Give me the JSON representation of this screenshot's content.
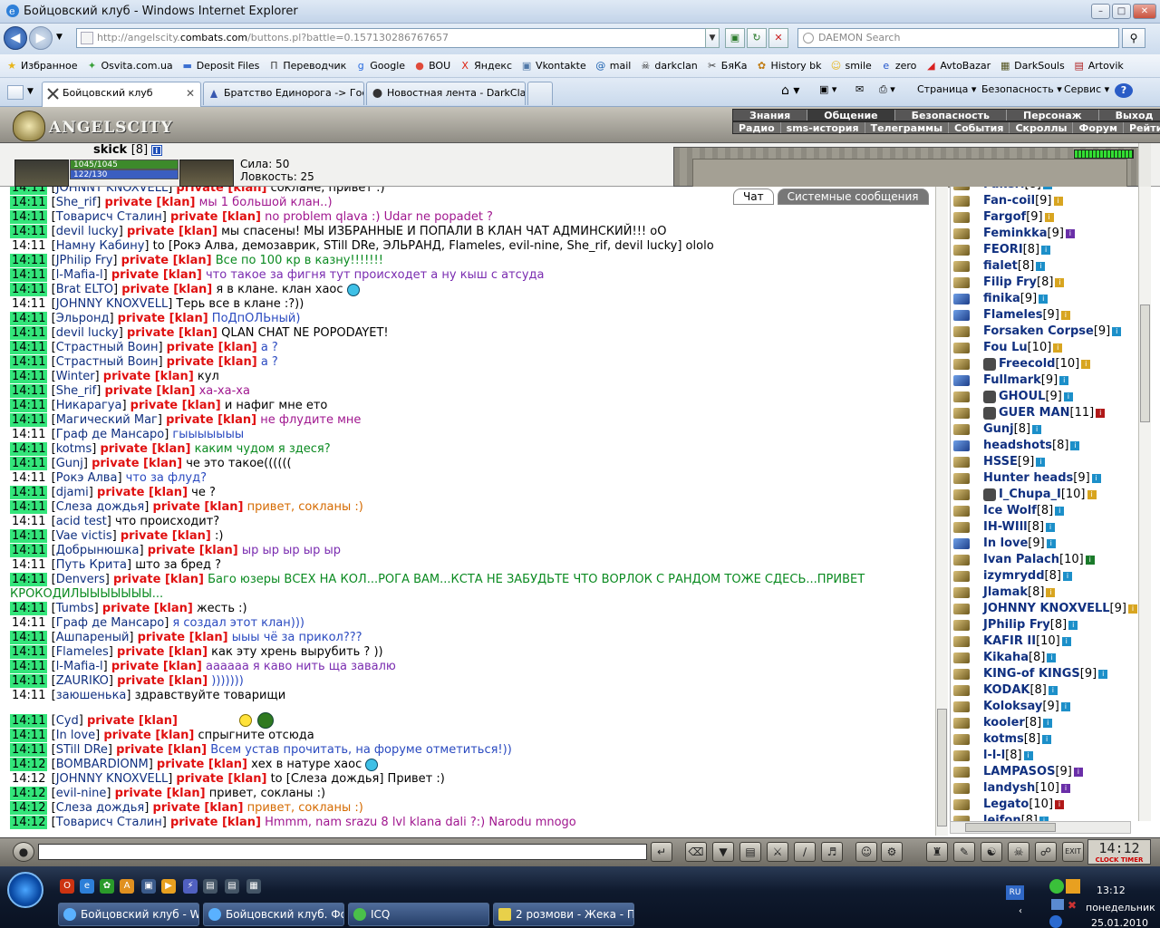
{
  "window": {
    "title": "Бойцовский клуб - Windows Internet Explorer",
    "controls": [
      "–",
      "□",
      "✕"
    ]
  },
  "address": {
    "prefix": "http://angelscity.",
    "domain": "combats.com",
    "suffix": "/buttons.pl?battle=0.157130286767657",
    "search_placeholder": "DAEMON Search"
  },
  "favorites": [
    {
      "label": "Избранное",
      "icon": "★",
      "color": "#e8b51a"
    },
    {
      "label": "Osvita.com.ua",
      "icon": "✦",
      "color": "#3aa03a"
    },
    {
      "label": "Deposit Files",
      "icon": "▬",
      "color": "#3b6fd1"
    },
    {
      "label": "Переводчик",
      "icon": "П",
      "color": "#444"
    },
    {
      "label": "Google",
      "icon": "g",
      "color": "#2a6ce0"
    },
    {
      "label": "BOU",
      "icon": "●",
      "color": "#e04a3a"
    },
    {
      "label": "Яндекс",
      "icon": "X",
      "color": "#d21"
    },
    {
      "label": "Vkontakte",
      "icon": "▣",
      "color": "#5078a8"
    },
    {
      "label": "mail",
      "icon": "@",
      "color": "#1a60b0"
    },
    {
      "label": "darkclan",
      "icon": "☠",
      "color": "#222"
    },
    {
      "label": "БяКа",
      "icon": "✂",
      "color": "#333"
    },
    {
      "label": "History bk",
      "icon": "✿",
      "color": "#c07a10"
    },
    {
      "label": "smile",
      "icon": "☺",
      "color": "#e8b51a"
    },
    {
      "label": "zero",
      "icon": "e",
      "color": "#2255cc"
    },
    {
      "label": "AvtoBazar",
      "icon": "◢",
      "color": "#d82020"
    },
    {
      "label": "DarkSouls",
      "icon": "▦",
      "color": "#552"
    },
    {
      "label": "Artovik",
      "icon": "▤",
      "color": "#b02020"
    }
  ],
  "tabs": [
    {
      "label": "Бойцовский клуб",
      "active": true,
      "close": "✕"
    },
    {
      "label": "Братство Единорога -> Гос...",
      "active": false
    },
    {
      "label": "Новостная лента - DarkClan",
      "active": false
    }
  ],
  "command_bar": {
    "page": "Страница",
    "safety": "Безопасность",
    "service": "Сервис",
    "help": "?"
  },
  "game": {
    "logo_text": "ANGELSCITY",
    "menu_top": [
      "Знания",
      "Общение",
      "Безопасность",
      "Персонаж",
      "Выход"
    ],
    "menu_bottom": [
      "Радио",
      "sms-история",
      "Телеграммы",
      "События",
      "Скроллы",
      "Форум",
      "Рейтинг"
    ],
    "user": {
      "name": "skick",
      "level": "[8]",
      "info": "i",
      "hp": "1045/1045",
      "mp": "122/130",
      "stat1": "Сила: 50",
      "stat2": "Ловкость: 25"
    },
    "chat_tabs": [
      "Чат",
      "Системные сообщения"
    ],
    "private_label": "private [klan]"
  },
  "chat": [
    {
      "t": "14:11",
      "g": true,
      "n": "JOHNNY KNOXVELL",
      "p": true,
      "m": "соклане, привет :)",
      "c": "#000"
    },
    {
      "t": "14:11",
      "g": true,
      "n": "She_rif",
      "p": true,
      "m": "мы 1 большой клан..)",
      "c": "#a0178f"
    },
    {
      "t": "14:11",
      "g": true,
      "n": "Товарисч Сталин",
      "p": true,
      "m": "no problem qlava :) Udar ne popadet ?",
      "c": "#a0178f"
    },
    {
      "t": "14:11",
      "g": true,
      "n": "devil lucky",
      "p": true,
      "m": "мы спасены! МЫ ИЗБРАННЫЕ И ПОПАЛИ В КЛАН ЧАТ АДМИНСКИЙ!!! оО",
      "c": "#000"
    },
    {
      "t": "14:11",
      "g": false,
      "n": "Намну Кабину",
      "p": false,
      "m": "to [Рокэ Алва, демозаврик, STill DRe, ЭЛЬРАНД, Flameles, evil-nine, She_rif, devil lucky] ololo",
      "c": "#000"
    },
    {
      "t": "14:11",
      "g": true,
      "n": "JPhilip Fry",
      "p": true,
      "m": "Все по 100 кр в казну!!!!!!!",
      "c": "#0a8a20"
    },
    {
      "t": "14:11",
      "g": true,
      "n": "l-Mafia-l",
      "p": true,
      "m": "что такое за фигня тут происходет а ну кыш с атсуда",
      "c": "#7a2cb0"
    },
    {
      "t": "14:11",
      "g": true,
      "n": "Brat ELTO",
      "p": true,
      "m": "я в клане. клан хаос",
      "c": "#000",
      "s": "b"
    },
    {
      "t": "14:11",
      "g": false,
      "n": "JOHNNY KNOXVELL",
      "p": false,
      "m": "Терь все в клане :?))",
      "c": "#000"
    },
    {
      "t": "14:11",
      "g": true,
      "n": "Эльронд",
      "p": true,
      "m": "ПоДпОЛЬный)",
      "c": "#2a4ac0"
    },
    {
      "t": "14:11",
      "g": true,
      "n": "devil lucky",
      "p": true,
      "m": "QLAN CHAT NE POPODAYET!",
      "c": "#000"
    },
    {
      "t": "14:11",
      "g": true,
      "n": "Страстный Воин",
      "p": true,
      "m": "а ?",
      "c": "#2a4ac0"
    },
    {
      "t": "14:11",
      "g": true,
      "n": "Страстный Воин",
      "p": true,
      "m": "а ?",
      "c": "#2a4ac0"
    },
    {
      "t": "14:11",
      "g": true,
      "n": "Winter",
      "p": true,
      "m": "кул",
      "c": "#000"
    },
    {
      "t": "14:11",
      "g": true,
      "n": "She_rif",
      "p": true,
      "m": "ха-ха-ха",
      "c": "#a0178f"
    },
    {
      "t": "14:11",
      "g": true,
      "n": "Никарагуа",
      "p": true,
      "m": "и нафиг мне ето",
      "c": "#000"
    },
    {
      "t": "14:11",
      "g": true,
      "n": "Магический Маг",
      "p": true,
      "m": "не флудите мне",
      "c": "#a0178f"
    },
    {
      "t": "14:11",
      "g": false,
      "n": "Граф де Мансаро",
      "p": false,
      "m": "гыыыыыыы",
      "c": "#2a4ac0"
    },
    {
      "t": "14:11",
      "g": true,
      "n": "kotms",
      "p": true,
      "m": "каким чудом я здеся?",
      "c": "#0a8a20"
    },
    {
      "t": "14:11",
      "g": true,
      "n": "Gunj",
      "p": true,
      "m": "че это такое((((((",
      "c": "#000"
    },
    {
      "t": "14:11",
      "g": false,
      "n": "Рокэ Алва",
      "p": false,
      "m": "что за флуд?",
      "c": "#2a4ac0"
    },
    {
      "t": "14:11",
      "g": true,
      "n": "djami",
      "p": true,
      "m": "че ?",
      "c": "#000"
    },
    {
      "t": "14:11",
      "g": true,
      "n": "Слеза дождья",
      "p": true,
      "m": "привет, сокланы :)",
      "c": "#d56a00"
    },
    {
      "t": "14:11",
      "g": false,
      "n": "acid test",
      "p": false,
      "m": "что происходит?",
      "c": "#000"
    },
    {
      "t": "14:11",
      "g": true,
      "n": "Vae victis",
      "p": true,
      "m": ":)",
      "c": "#000"
    },
    {
      "t": "14:11",
      "g": true,
      "n": "Добрынюшка",
      "p": true,
      "m": "ыр ыр ыр ыр ыр",
      "c": "#7a2cb0"
    },
    {
      "t": "14:11",
      "g": false,
      "n": "Путь Крита",
      "p": false,
      "m": "што за бред ?",
      "c": "#000"
    },
    {
      "t": "14:11",
      "g": true,
      "n": "Denvers",
      "p": true,
      "m": "Баго юзеры ВСЕХ НА КОЛ...РОГА ВАМ...КСТА НЕ ЗАБУДЬТЕ ЧТО ВОРЛОК С РАНДОМ ТОЖЕ СДЕСЬ...ПРИВЕТ КРОКОДИЛЫЫЫЫЫЫЫ...",
      "c": "#0a8a20",
      "w": true
    },
    {
      "t": "14:11",
      "g": true,
      "n": "Tumbs",
      "p": true,
      "m": "жесть :)",
      "c": "#000"
    },
    {
      "t": "14:11",
      "g": false,
      "n": "Граф де Мансаро",
      "p": false,
      "m": "я создал этот клан)))",
      "c": "#2a4ac0"
    },
    {
      "t": "14:11",
      "g": true,
      "n": "Ашпареный",
      "p": true,
      "m": "ыыы чё за прикол???",
      "c": "#2a4ac0"
    },
    {
      "t": "14:11",
      "g": true,
      "n": "Flameles",
      "p": true,
      "m": "как эту хрень вырубить ? ))",
      "c": "#000"
    },
    {
      "t": "14:11",
      "g": true,
      "n": "l-Mafia-l",
      "p": true,
      "m": "аааааа я каво нить ща завалю",
      "c": "#7a2cb0"
    },
    {
      "t": "14:11",
      "g": true,
      "n": "ZAURIKO",
      "p": true,
      "m": ")))))))",
      "c": "#2a4ac0"
    },
    {
      "t": "14:11",
      "g": false,
      "n": "заюшенька",
      "p": false,
      "m": "здравствуйте товарищи",
      "c": "#000"
    },
    {
      "gap": true
    },
    {
      "t": "14:11",
      "g": true,
      "n": "Cyd",
      "p": true,
      "m": "",
      "c": "#000",
      "s": "cyd"
    },
    {
      "t": "14:11",
      "g": true,
      "n": "In love",
      "p": true,
      "m": "спрыгните отсюда",
      "c": "#000"
    },
    {
      "t": "14:11",
      "g": true,
      "n": "STill DRe",
      "p": true,
      "m": "Всем устав прочитать, на форуме отметиться!))",
      "c": "#2a4ac0"
    },
    {
      "t": "14:12",
      "g": true,
      "n": "BOMBARDIONM",
      "p": true,
      "m": "хех в натуре хаос",
      "c": "#000",
      "s": "b"
    },
    {
      "t": "14:12",
      "g": false,
      "n": "JOHNNY KNOXVELL",
      "p": true,
      "m": "to [Слеза дождья] Привет :)",
      "c": "#000"
    },
    {
      "t": "14:12",
      "g": true,
      "n": "evil-nine",
      "p": true,
      "m": "привет, сокланы :)",
      "c": "#000"
    },
    {
      "t": "14:12",
      "g": true,
      "n": "Слеза дождья",
      "p": true,
      "m": "привет, сокланы :)",
      "c": "#d56a00"
    },
    {
      "t": "14:12",
      "g": true,
      "n": "Товарисч Сталин",
      "p": true,
      "m": "Hmmm, nam srazu 8 lvl klana dali ?:) Narodu mnogo",
      "c": "#a0178f"
    }
  ],
  "users": [
    {
      "n": "Fukeri",
      "l": "[8]",
      "ic": "#1c8fc9"
    },
    {
      "n": "Fan-coil",
      "l": "[9]",
      "ic": "#d8a520"
    },
    {
      "n": "Fargof",
      "l": "[9]",
      "ic": "#d8a520"
    },
    {
      "n": "Feminkka",
      "l": "[9]",
      "ic": "#6a2fa8"
    },
    {
      "n": "FEORI",
      "l": "[8]",
      "ic": "#1c8fc9"
    },
    {
      "n": "fialet",
      "l": "[8]",
      "ic": "#1c8fc9"
    },
    {
      "n": "Filip Fry",
      "l": "[8]",
      "ic": "#d8a520"
    },
    {
      "n": "finika",
      "l": "[9]",
      "ic": "#1c8fc9",
      "b": true
    },
    {
      "n": "Flameles",
      "l": "[9]",
      "ic": "#d8a520",
      "b": true
    },
    {
      "n": "Forsaken Corpse",
      "l": "[9]",
      "ic": "#1c8fc9"
    },
    {
      "n": "Fou Lu",
      "l": "[10]",
      "ic": "#d8a520"
    },
    {
      "n": "Freecold",
      "l": "[10]",
      "ic": "#d8a520",
      "cl": true
    },
    {
      "n": "Fullmark",
      "l": "[9]",
      "ic": "#1c8fc9",
      "b": true
    },
    {
      "n": "GHOUL",
      "l": "[9]",
      "ic": "#1c8fc9",
      "cl": true
    },
    {
      "n": "GUER MAN",
      "l": "[11]",
      "ic": "#b01818",
      "cl": true
    },
    {
      "n": "Gunj",
      "l": "[8]",
      "ic": "#1c8fc9"
    },
    {
      "n": "headshots",
      "l": "[8]",
      "ic": "#1c8fc9",
      "b": true
    },
    {
      "n": "HSSE",
      "l": "[9]",
      "ic": "#1c8fc9"
    },
    {
      "n": "Hunter heads",
      "l": "[9]",
      "ic": "#1c8fc9"
    },
    {
      "n": "I_Chupa_I",
      "l": "[10]",
      "ic": "#d8a520",
      "cl": true
    },
    {
      "n": "Ice Wolf",
      "l": "[8]",
      "ic": "#1c8fc9"
    },
    {
      "n": "IH-WIll",
      "l": "[8]",
      "ic": "#1c8fc9"
    },
    {
      "n": "In love",
      "l": "[9]",
      "ic": "#1c8fc9",
      "b": true
    },
    {
      "n": "Ivan Palach",
      "l": "[10]",
      "ic": "#1a7a2a"
    },
    {
      "n": "izymrydd",
      "l": "[8]",
      "ic": "#1c8fc9"
    },
    {
      "n": "Jlamak",
      "l": "[8]",
      "ic": "#d8a520"
    },
    {
      "n": "JOHNNY KNOXVELL",
      "l": "[9]",
      "ic": "#d8a520"
    },
    {
      "n": "JPhilip Fry",
      "l": "[8]",
      "ic": "#1c8fc9"
    },
    {
      "n": "KAFIR II",
      "l": "[10]",
      "ic": "#1c8fc9"
    },
    {
      "n": "Kikaha",
      "l": "[8]",
      "ic": "#1c8fc9"
    },
    {
      "n": "KING-of KINGS",
      "l": "[9]",
      "ic": "#1c8fc9"
    },
    {
      "n": "KODAK",
      "l": "[8]",
      "ic": "#1c8fc9"
    },
    {
      "n": "Koloksay",
      "l": "[9]",
      "ic": "#1c8fc9"
    },
    {
      "n": "kooler",
      "l": "[8]",
      "ic": "#1c8fc9"
    },
    {
      "n": "kotms",
      "l": "[8]",
      "ic": "#1c8fc9"
    },
    {
      "n": "l-l-l",
      "l": "[8]",
      "ic": "#1c8fc9"
    },
    {
      "n": "LAMPASOS",
      "l": "[9]",
      "ic": "#6a2fa8"
    },
    {
      "n": "landysh",
      "l": "[10]",
      "ic": "#6a2fa8"
    },
    {
      "n": "Legato",
      "l": "[10]",
      "ic": "#b01818"
    },
    {
      "n": "leifon",
      "l": "[8]",
      "ic": "#1c8fc9"
    }
  ],
  "clock": {
    "time": "14:12",
    "caption": "CLOCK TIMER"
  },
  "taskbar": {
    "buttons": [
      "Бойцовский клуб - Wi...",
      "Бойцовский клуб. Фо...",
      "ICQ",
      "2 розмови - Жека - П..."
    ],
    "lang": "RU",
    "time": "13:12",
    "day": "понедельник",
    "date": "25.01.2010"
  }
}
